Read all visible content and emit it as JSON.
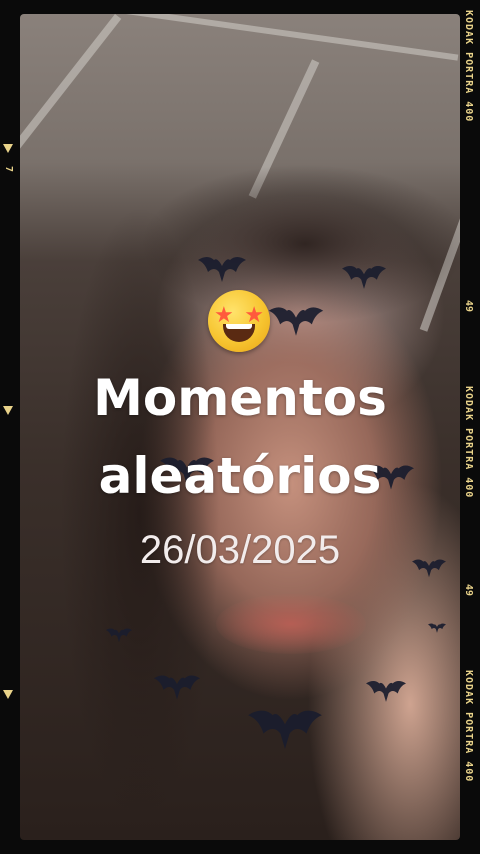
{
  "story": {
    "title_line1": "Momentos",
    "title_line2": "aleatórios",
    "date": "26/03/2025",
    "emoji": "star-struck-emoji"
  },
  "film_border": {
    "brand": "KODAK PORTRA 400",
    "frame_number": "49",
    "left_number": "7",
    "accent_color": "#e9d38a"
  }
}
